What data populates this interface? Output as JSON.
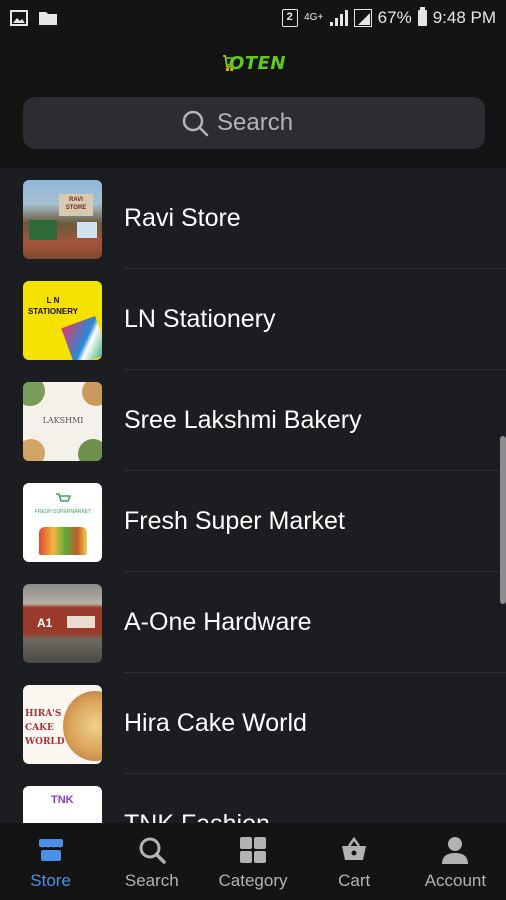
{
  "status_bar": {
    "sim_badge": "2",
    "network": "4G+",
    "battery": "67%",
    "time": "9:48 PM"
  },
  "header": {
    "logo_text": "OTEN",
    "search_placeholder": "Search"
  },
  "stores": [
    {
      "name": "Ravi Store",
      "thumb_text": "RAVI STORE"
    },
    {
      "name": "LN Stationery",
      "thumb_text": "L N STATIONERY"
    },
    {
      "name": "Sree Lakshmi Bakery",
      "thumb_text": "LAKSHMI"
    },
    {
      "name": "Fresh Super Market",
      "thumb_text": "FRESH SUPERMARKET"
    },
    {
      "name": "A-One Hardware",
      "thumb_text": "A1"
    },
    {
      "name": "Hira Cake World",
      "thumb_text": "HIRA'S CAKE WORLD"
    },
    {
      "name": "TNK Fashion",
      "thumb_text": "TNK"
    }
  ],
  "bottom_nav": [
    {
      "label": "Store",
      "icon": "store-icon",
      "active": true
    },
    {
      "label": "Search",
      "icon": "search-icon",
      "active": false
    },
    {
      "label": "Category",
      "icon": "category-grid-icon",
      "active": false
    },
    {
      "label": "Cart",
      "icon": "cart-basket-icon",
      "active": false
    },
    {
      "label": "Account",
      "icon": "account-icon",
      "active": false
    }
  ],
  "colors": {
    "background": "#1c1d20",
    "bars": "#141414",
    "accent": "#4c8fe6",
    "logo": "#62c91b"
  }
}
